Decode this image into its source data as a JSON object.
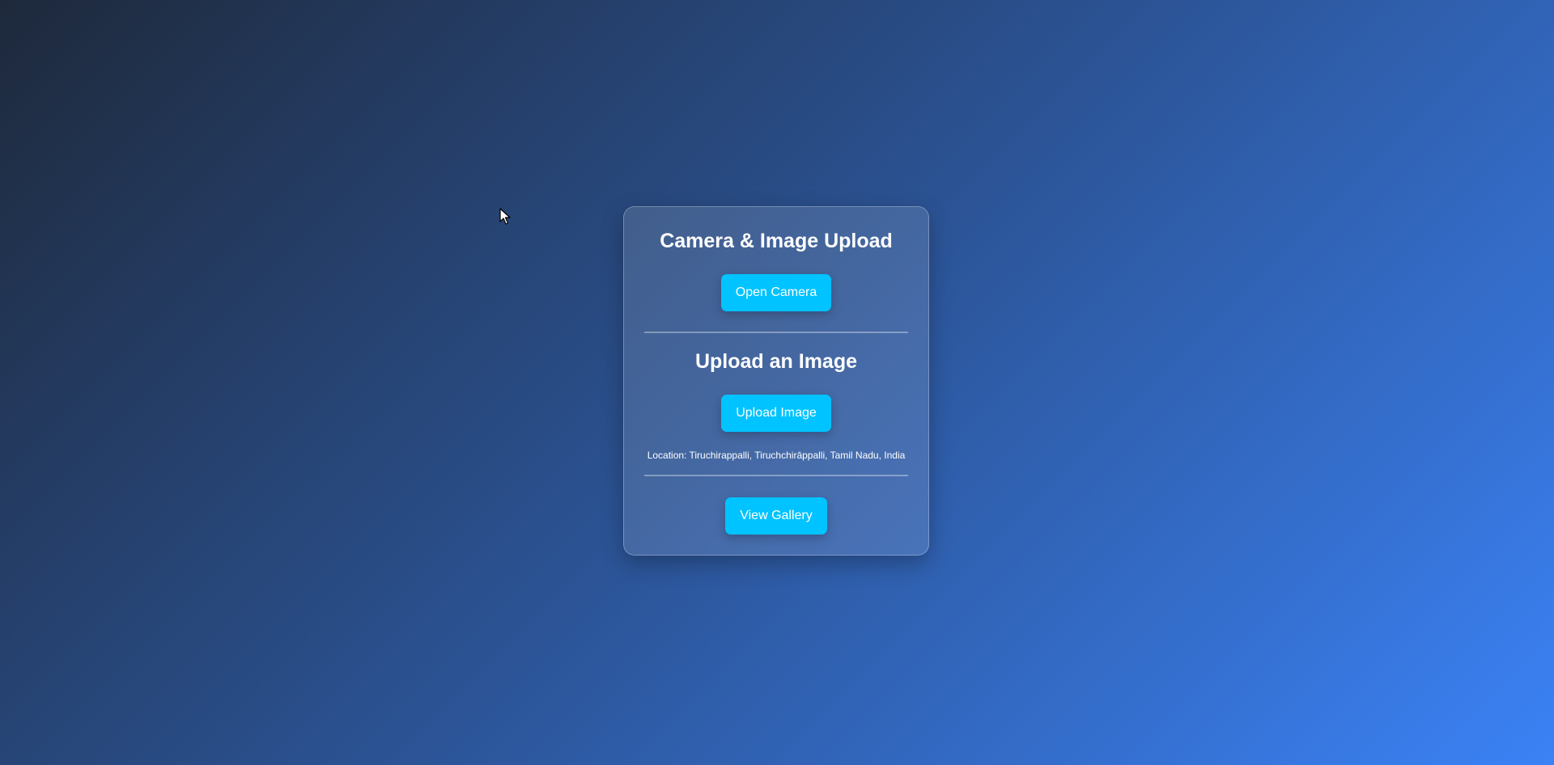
{
  "card": {
    "camera_title": "Camera & Image Upload",
    "open_camera_label": "Open Camera",
    "upload_title": "Upload an Image",
    "upload_image_label": "Upload Image",
    "location_text": "Location: Tiruchirappalli, Tiruchchirāppalli, Tamil Nadu, India",
    "view_gallery_label": "View Gallery"
  },
  "colors": {
    "background_start": "#1e293b",
    "background_end": "#3b82f6",
    "button": "#00c3ff",
    "text": "#ffffff"
  },
  "icons": {
    "cursor": "mouse-pointer-icon"
  }
}
